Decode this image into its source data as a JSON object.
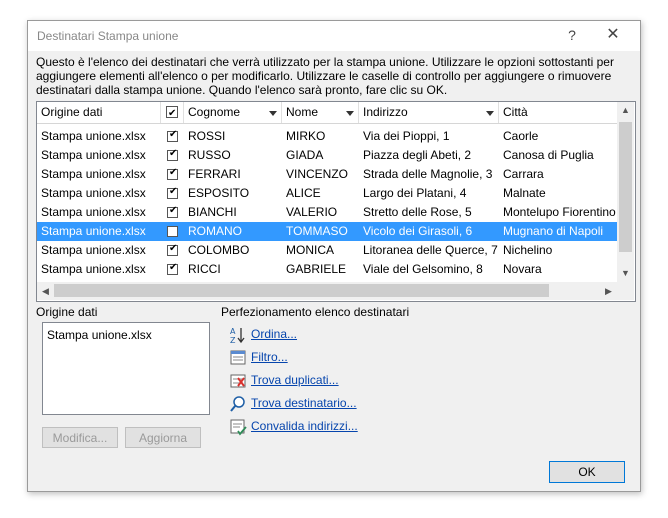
{
  "window": {
    "title": "Destinatari Stampa unione",
    "help_glyph": "?",
    "close_glyph": "✕"
  },
  "description": "Questo è l'elenco dei destinatari che verrà utilizzato per la stampa unione. Utilizzare le opzioni sottostanti per aggiungere elementi all'elenco o per modificarlo. Utilizzare le caselle di controllo per aggiungere o rimuovere destinatari dalla stampa unione. Quando l'elenco sarà pronto, fare clic su OK.",
  "table": {
    "headers": {
      "origin": "Origine dati",
      "surname": "Cognome",
      "name": "Nome",
      "address": "Indirizzo",
      "city": "Città"
    },
    "rows": [
      {
        "origin": "Stampa unione.xlsx",
        "checked": true,
        "surname": "ROSSI",
        "name": "MIRKO",
        "address": "Via dei Pioppi, 1",
        "city": "Caorle"
      },
      {
        "origin": "Stampa unione.xlsx",
        "checked": true,
        "surname": "RUSSO",
        "name": "GIADA",
        "address": "Piazza degli Abeti, 2",
        "city": "Canosa di Puglia"
      },
      {
        "origin": "Stampa unione.xlsx",
        "checked": true,
        "surname": "FERRARI",
        "name": "VINCENZO",
        "address": "Strada delle Magnolie, 3",
        "city": "Carrara"
      },
      {
        "origin": "Stampa unione.xlsx",
        "checked": true,
        "surname": "ESPOSITO",
        "name": "ALICE",
        "address": "Largo dei Platani, 4",
        "city": "Malnate"
      },
      {
        "origin": "Stampa unione.xlsx",
        "checked": true,
        "surname": "BIANCHI",
        "name": "VALERIO",
        "address": "Stretto delle Rose, 5",
        "city": "Montelupo Fiorentino"
      },
      {
        "origin": "Stampa unione.xlsx",
        "checked": false,
        "selected": true,
        "surname": "ROMANO",
        "name": "TOMMASO",
        "address": "Vicolo dei Girasoli, 6",
        "city": "Mugnano di Napoli"
      },
      {
        "origin": "Stampa unione.xlsx",
        "checked": true,
        "surname": "COLOMBO",
        "name": "MONICA",
        "address": "Litoranea delle Querce, 7",
        "city": "Nichelino"
      },
      {
        "origin": "Stampa unione.xlsx",
        "checked": true,
        "surname": "RICCI",
        "name": "GABRIELE",
        "address": "Viale del Gelsomino, 8",
        "city": "Novara"
      }
    ]
  },
  "data_source": {
    "label": "Origine dati",
    "items": [
      "Stampa unione.xlsx"
    ],
    "edit_label": "Modifica...",
    "refresh_label": "Aggiorna"
  },
  "refine": {
    "label": "Perfezionamento elenco destinatari",
    "links": [
      {
        "label": "Ordina...",
        "icon": "sort-az-icon"
      },
      {
        "label": "Filtro...",
        "icon": "filter-icon"
      },
      {
        "label": "Trova duplicati...",
        "icon": "find-duplicates-icon"
      },
      {
        "label": "Trova destinatario...",
        "icon": "find-recipient-icon"
      },
      {
        "label": "Convalida indirizzi...",
        "icon": "validate-addresses-icon"
      }
    ]
  },
  "ok_label": "OK",
  "colors": {
    "selection": "#3399ff",
    "link": "#0645ad",
    "ok_border": "#0078d7"
  }
}
